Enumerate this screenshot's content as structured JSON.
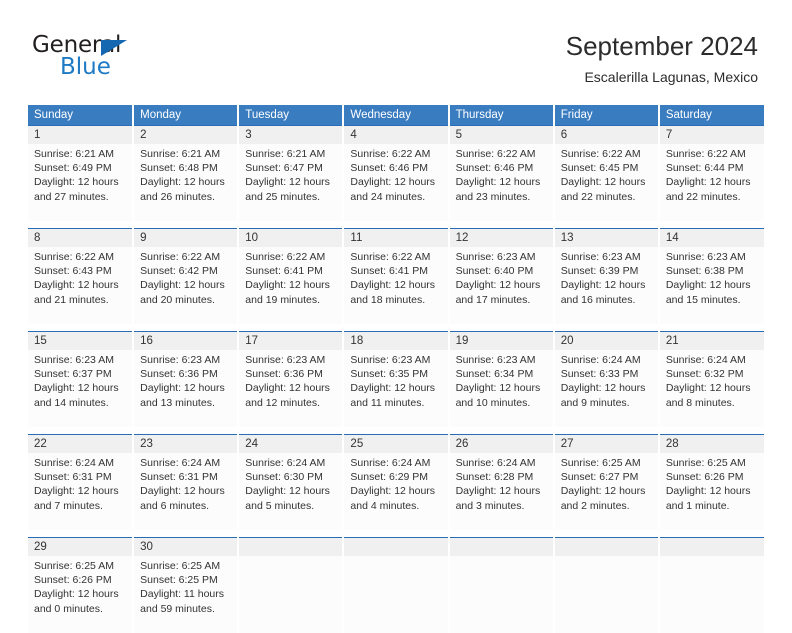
{
  "brand": {
    "name_part1": "General",
    "name_part2": "Blue",
    "accent_color": "#1e7ac4",
    "triangle_color": "#1667b1"
  },
  "header": {
    "title": "September 2024",
    "subtitle": "Escalerilla Lagunas, Mexico"
  },
  "theme": {
    "header_bg": "#3a7cc0",
    "daynum_bg": "#f0f0f0",
    "daynum_rule": "#2a6db4",
    "cell_bg": "#fcfcfc"
  },
  "weekdays": [
    "Sunday",
    "Monday",
    "Tuesday",
    "Wednesday",
    "Thursday",
    "Friday",
    "Saturday"
  ],
  "weeks": [
    [
      {
        "day": "1",
        "sunrise": "Sunrise: 6:21 AM",
        "sunset": "Sunset: 6:49 PM",
        "daylight1": "Daylight: 12 hours",
        "daylight2": "and 27 minutes."
      },
      {
        "day": "2",
        "sunrise": "Sunrise: 6:21 AM",
        "sunset": "Sunset: 6:48 PM",
        "daylight1": "Daylight: 12 hours",
        "daylight2": "and 26 minutes."
      },
      {
        "day": "3",
        "sunrise": "Sunrise: 6:21 AM",
        "sunset": "Sunset: 6:47 PM",
        "daylight1": "Daylight: 12 hours",
        "daylight2": "and 25 minutes."
      },
      {
        "day": "4",
        "sunrise": "Sunrise: 6:22 AM",
        "sunset": "Sunset: 6:46 PM",
        "daylight1": "Daylight: 12 hours",
        "daylight2": "and 24 minutes."
      },
      {
        "day": "5",
        "sunrise": "Sunrise: 6:22 AM",
        "sunset": "Sunset: 6:46 PM",
        "daylight1": "Daylight: 12 hours",
        "daylight2": "and 23 minutes."
      },
      {
        "day": "6",
        "sunrise": "Sunrise: 6:22 AM",
        "sunset": "Sunset: 6:45 PM",
        "daylight1": "Daylight: 12 hours",
        "daylight2": "and 22 minutes."
      },
      {
        "day": "7",
        "sunrise": "Sunrise: 6:22 AM",
        "sunset": "Sunset: 6:44 PM",
        "daylight1": "Daylight: 12 hours",
        "daylight2": "and 22 minutes."
      }
    ],
    [
      {
        "day": "8",
        "sunrise": "Sunrise: 6:22 AM",
        "sunset": "Sunset: 6:43 PM",
        "daylight1": "Daylight: 12 hours",
        "daylight2": "and 21 minutes."
      },
      {
        "day": "9",
        "sunrise": "Sunrise: 6:22 AM",
        "sunset": "Sunset: 6:42 PM",
        "daylight1": "Daylight: 12 hours",
        "daylight2": "and 20 minutes."
      },
      {
        "day": "10",
        "sunrise": "Sunrise: 6:22 AM",
        "sunset": "Sunset: 6:41 PM",
        "daylight1": "Daylight: 12 hours",
        "daylight2": "and 19 minutes."
      },
      {
        "day": "11",
        "sunrise": "Sunrise: 6:22 AM",
        "sunset": "Sunset: 6:41 PM",
        "daylight1": "Daylight: 12 hours",
        "daylight2": "and 18 minutes."
      },
      {
        "day": "12",
        "sunrise": "Sunrise: 6:23 AM",
        "sunset": "Sunset: 6:40 PM",
        "daylight1": "Daylight: 12 hours",
        "daylight2": "and 17 minutes."
      },
      {
        "day": "13",
        "sunrise": "Sunrise: 6:23 AM",
        "sunset": "Sunset: 6:39 PM",
        "daylight1": "Daylight: 12 hours",
        "daylight2": "and 16 minutes."
      },
      {
        "day": "14",
        "sunrise": "Sunrise: 6:23 AM",
        "sunset": "Sunset: 6:38 PM",
        "daylight1": "Daylight: 12 hours",
        "daylight2": "and 15 minutes."
      }
    ],
    [
      {
        "day": "15",
        "sunrise": "Sunrise: 6:23 AM",
        "sunset": "Sunset: 6:37 PM",
        "daylight1": "Daylight: 12 hours",
        "daylight2": "and 14 minutes."
      },
      {
        "day": "16",
        "sunrise": "Sunrise: 6:23 AM",
        "sunset": "Sunset: 6:36 PM",
        "daylight1": "Daylight: 12 hours",
        "daylight2": "and 13 minutes."
      },
      {
        "day": "17",
        "sunrise": "Sunrise: 6:23 AM",
        "sunset": "Sunset: 6:36 PM",
        "daylight1": "Daylight: 12 hours",
        "daylight2": "and 12 minutes."
      },
      {
        "day": "18",
        "sunrise": "Sunrise: 6:23 AM",
        "sunset": "Sunset: 6:35 PM",
        "daylight1": "Daylight: 12 hours",
        "daylight2": "and 11 minutes."
      },
      {
        "day": "19",
        "sunrise": "Sunrise: 6:23 AM",
        "sunset": "Sunset: 6:34 PM",
        "daylight1": "Daylight: 12 hours",
        "daylight2": "and 10 minutes."
      },
      {
        "day": "20",
        "sunrise": "Sunrise: 6:24 AM",
        "sunset": "Sunset: 6:33 PM",
        "daylight1": "Daylight: 12 hours",
        "daylight2": "and 9 minutes."
      },
      {
        "day": "21",
        "sunrise": "Sunrise: 6:24 AM",
        "sunset": "Sunset: 6:32 PM",
        "daylight1": "Daylight: 12 hours",
        "daylight2": "and 8 minutes."
      }
    ],
    [
      {
        "day": "22",
        "sunrise": "Sunrise: 6:24 AM",
        "sunset": "Sunset: 6:31 PM",
        "daylight1": "Daylight: 12 hours",
        "daylight2": "and 7 minutes."
      },
      {
        "day": "23",
        "sunrise": "Sunrise: 6:24 AM",
        "sunset": "Sunset: 6:31 PM",
        "daylight1": "Daylight: 12 hours",
        "daylight2": "and 6 minutes."
      },
      {
        "day": "24",
        "sunrise": "Sunrise: 6:24 AM",
        "sunset": "Sunset: 6:30 PM",
        "daylight1": "Daylight: 12 hours",
        "daylight2": "and 5 minutes."
      },
      {
        "day": "25",
        "sunrise": "Sunrise: 6:24 AM",
        "sunset": "Sunset: 6:29 PM",
        "daylight1": "Daylight: 12 hours",
        "daylight2": "and 4 minutes."
      },
      {
        "day": "26",
        "sunrise": "Sunrise: 6:24 AM",
        "sunset": "Sunset: 6:28 PM",
        "daylight1": "Daylight: 12 hours",
        "daylight2": "and 3 minutes."
      },
      {
        "day": "27",
        "sunrise": "Sunrise: 6:25 AM",
        "sunset": "Sunset: 6:27 PM",
        "daylight1": "Daylight: 12 hours",
        "daylight2": "and 2 minutes."
      },
      {
        "day": "28",
        "sunrise": "Sunrise: 6:25 AM",
        "sunset": "Sunset: 6:26 PM",
        "daylight1": "Daylight: 12 hours",
        "daylight2": "and 1 minute."
      }
    ],
    [
      {
        "day": "29",
        "sunrise": "Sunrise: 6:25 AM",
        "sunset": "Sunset: 6:26 PM",
        "daylight1": "Daylight: 12 hours",
        "daylight2": "and 0 minutes."
      },
      {
        "day": "30",
        "sunrise": "Sunrise: 6:25 AM",
        "sunset": "Sunset: 6:25 PM",
        "daylight1": "Daylight: 11 hours",
        "daylight2": "and 59 minutes."
      },
      {
        "day": "",
        "sunrise": "",
        "sunset": "",
        "daylight1": "",
        "daylight2": ""
      },
      {
        "day": "",
        "sunrise": "",
        "sunset": "",
        "daylight1": "",
        "daylight2": ""
      },
      {
        "day": "",
        "sunrise": "",
        "sunset": "",
        "daylight1": "",
        "daylight2": ""
      },
      {
        "day": "",
        "sunrise": "",
        "sunset": "",
        "daylight1": "",
        "daylight2": ""
      },
      {
        "day": "",
        "sunrise": "",
        "sunset": "",
        "daylight1": "",
        "daylight2": ""
      }
    ]
  ]
}
